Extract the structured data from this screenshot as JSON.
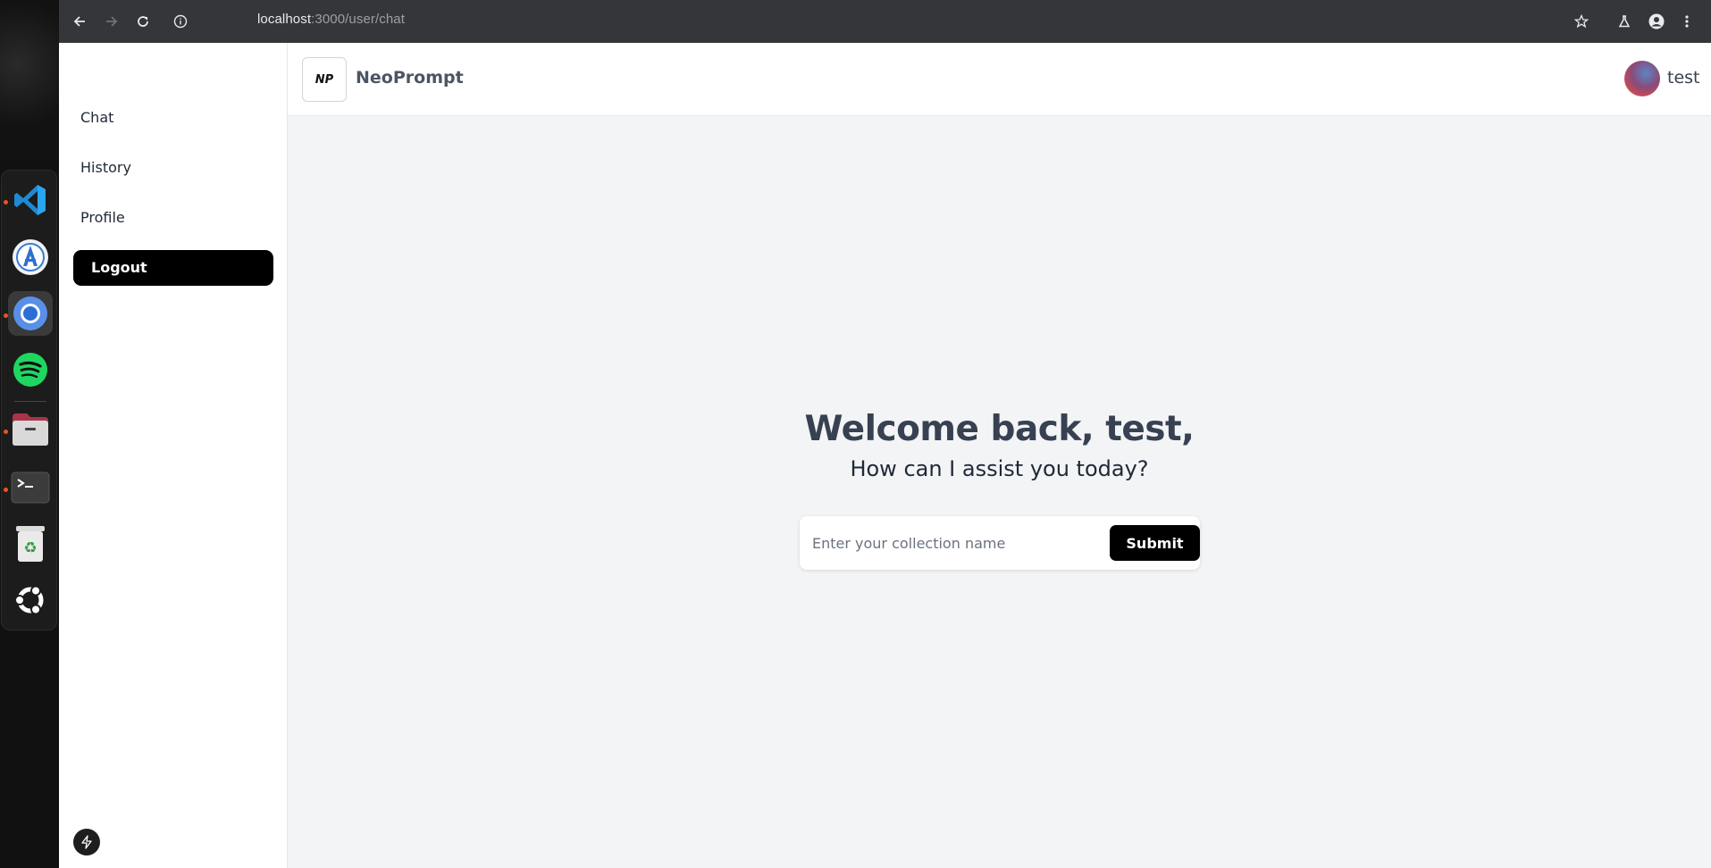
{
  "browser": {
    "url_host": "localhost",
    "url_path": ":3000/user/chat"
  },
  "dock": {
    "apps": [
      {
        "name": "vscode-icon",
        "running": true
      },
      {
        "name": "android-studio-icon",
        "running": false
      },
      {
        "name": "chrome-icon",
        "running": true,
        "active": true
      },
      {
        "name": "spotify-icon",
        "running": false
      },
      {
        "name": "files-icon",
        "running": true
      },
      {
        "name": "terminal-icon",
        "running": true
      },
      {
        "name": "trash-icon",
        "running": false
      },
      {
        "name": "ubuntu-apps-icon",
        "running": false
      }
    ]
  },
  "sidebar": {
    "items": [
      {
        "label": "Chat"
      },
      {
        "label": "History"
      },
      {
        "label": "Profile"
      }
    ],
    "logout_label": "Logout"
  },
  "header": {
    "logo_text": "NP",
    "brand": "NeoPrompt",
    "username": "test"
  },
  "main": {
    "greeting": "Welcome back, test,",
    "subtitle": "How can I assist you today?",
    "input_placeholder": "Enter your collection name",
    "input_value": "",
    "submit_label": "Submit"
  },
  "colors": {
    "accent": "#000000",
    "page_bg": "#f3f4f6",
    "chrome_bg": "#35363a"
  }
}
